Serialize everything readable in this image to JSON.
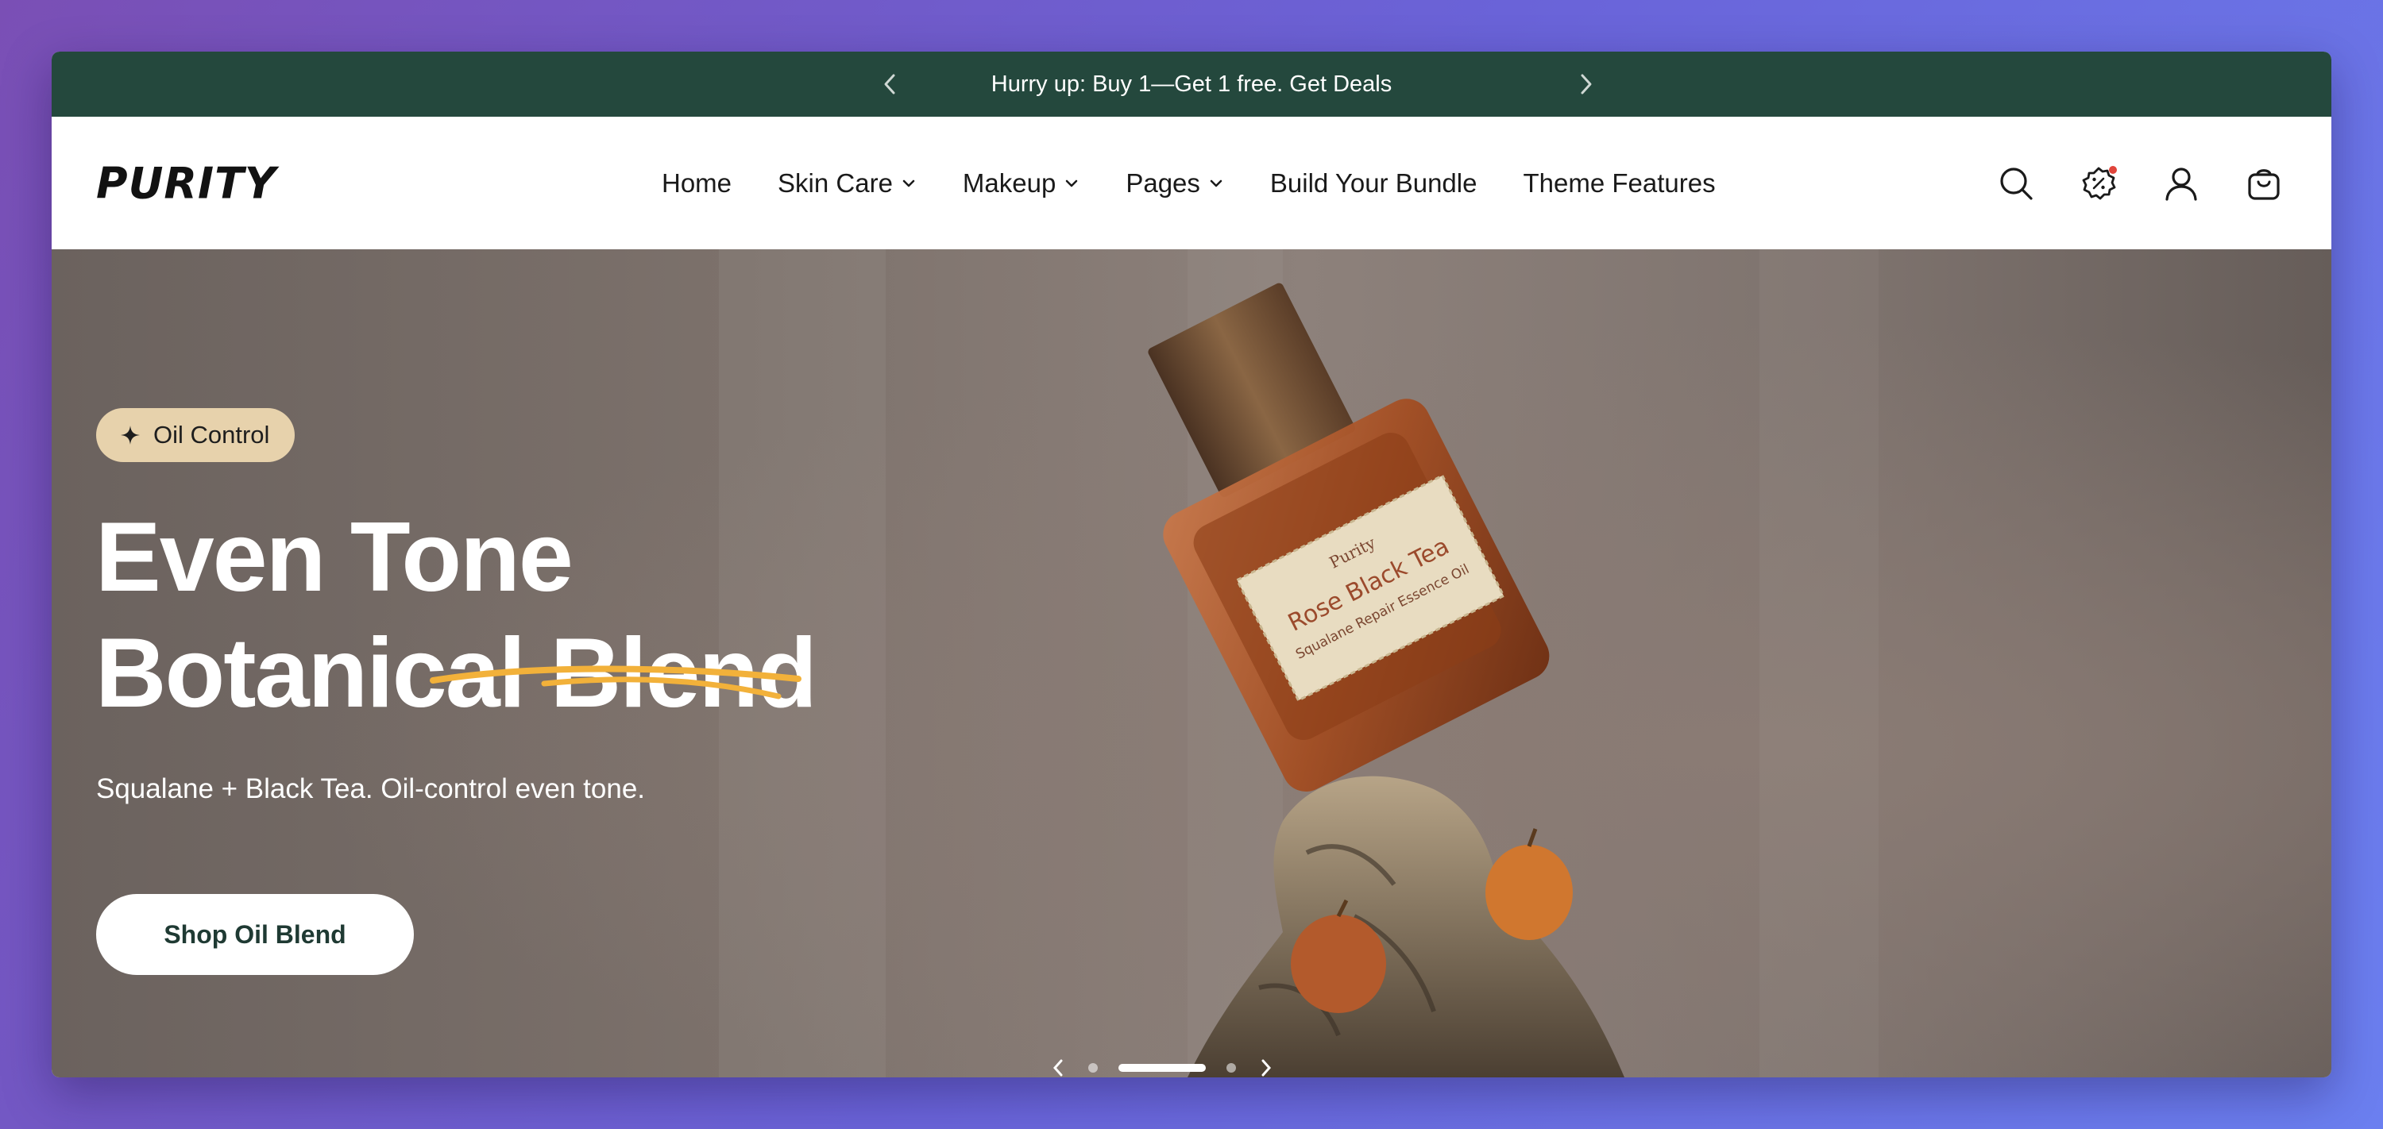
{
  "announcement": {
    "text": "Hurry up: Buy 1—Get 1 free. Get Deals",
    "prev_icon": "chevron-left-icon",
    "next_icon": "chevron-right-icon"
  },
  "header": {
    "logo": "PURITY",
    "nav": [
      {
        "label": "Home",
        "dropdown": false
      },
      {
        "label": "Skin Care",
        "dropdown": true
      },
      {
        "label": "Makeup",
        "dropdown": true
      },
      {
        "label": "Pages",
        "dropdown": true
      },
      {
        "label": "Build Your Bundle",
        "dropdown": false
      },
      {
        "label": "Theme Features",
        "dropdown": false
      }
    ],
    "tools": [
      "search-icon",
      "discount-badge-icon",
      "account-icon",
      "cart-icon"
    ]
  },
  "hero": {
    "tag": "Oil Control",
    "headline_line1": "Even Tone",
    "headline_line2": "Botanical Blend",
    "subtitle": "Squalane + Black Tea. Oil-control even tone.",
    "cta": "Shop Oil Blend",
    "product_label_brand": "Purity",
    "product_label_name": "Rose Black Tea",
    "product_label_sub": "Squalane Repair Essence Oil"
  },
  "colors": {
    "announce_bg": "#24483d",
    "tag_bg": "#e7d2ac",
    "underline": "#f2b13a",
    "badge": "#e0443b"
  }
}
